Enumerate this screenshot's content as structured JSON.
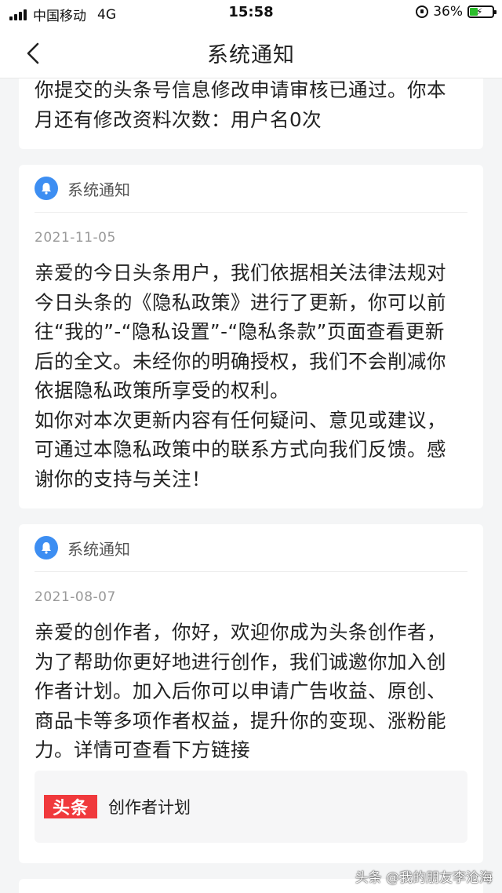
{
  "status_bar": {
    "carrier": "中国移动",
    "network": "4G",
    "time": "15:58",
    "battery": "36%"
  },
  "nav": {
    "title": "系统通知"
  },
  "cards": [
    {
      "lines": [
        "你提交的头条号信息修改申请审核已通过。你本",
        "月还有修改资料次数：用户名0次"
      ]
    },
    {
      "source": "系统通知",
      "date": "2021-11-05",
      "lines": [
        "亲爱的今日头条用户，我们依据相关法律法规对",
        "今日头条的《隐私政策》进行了更新，你可以前",
        "往“我的”-“隐私设置”-“隐私条款”页面查看更新",
        "后的全文。未经你的明确授权，我们不会削减你",
        "依据隐私政策所享受的权利。",
        "如你对本次更新内容有任何疑问、意见或建议，",
        "可通过本隐私政策中的联系方式向我们反馈。感",
        "谢你的支持与关注！"
      ]
    },
    {
      "source": "系统通知",
      "date": "2021-08-07",
      "lines": [
        "亲爱的创作者，你好，欢迎你成为头条创作者，",
        "为了帮助你更好地进行创作，我们诚邀你加入创",
        "作者计划。加入后你可以申请广告收益、原创、",
        "商品卡等多项作者权益，提升你的变现、涨粉能",
        "力。详情可查看下方链接"
      ],
      "link": {
        "logo_text": "头条",
        "label": "创作者计划"
      }
    }
  ],
  "watermark": "头条 @我的朋友李沧海",
  "colors": {
    "bell": "#3d8ef2",
    "logo": "#f0393c",
    "battery_fill": "#2bbd2b"
  },
  "icons": {
    "back": "chevron-left-icon",
    "bell": "bell-icon"
  }
}
